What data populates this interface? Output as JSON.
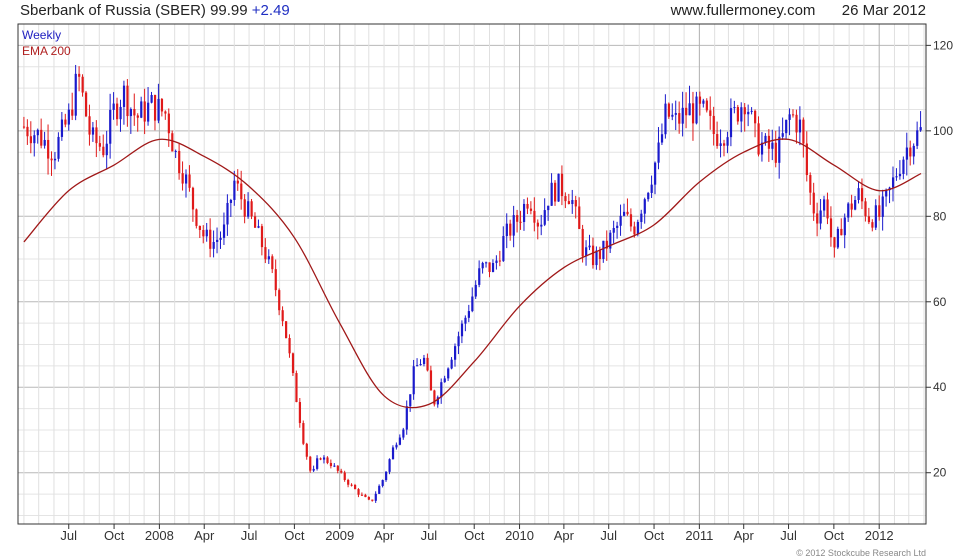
{
  "header": {
    "title": "Sberbank of Russia (SBER) 99.99",
    "change": "+2.49",
    "site": "www.fullermoney.com",
    "date": "26 Mar 2012"
  },
  "legend": {
    "weekly": "Weekly",
    "ema": "EMA 200"
  },
  "footer": {
    "copyright": "© 2012 Stockcube Research Ltd"
  },
  "colors": {
    "up": "#1a1acc",
    "down": "#e01a1a",
    "ema": "#a01818",
    "grid": "#c8c8c8",
    "axis": "#333333"
  },
  "chart_data": {
    "type": "line",
    "ylim": [
      8,
      125
    ],
    "yticks": [
      20,
      40,
      60,
      80,
      100,
      120
    ],
    "grid": true,
    "legend_position": "top-left",
    "xticks": [
      {
        "label": "Jul",
        "date": "2007-07-01"
      },
      {
        "label": "Oct",
        "date": "2007-10-01"
      },
      {
        "label": "2008",
        "date": "2008-01-01"
      },
      {
        "label": "Apr",
        "date": "2008-04-01"
      },
      {
        "label": "Jul",
        "date": "2008-07-01"
      },
      {
        "label": "Oct",
        "date": "2008-10-01"
      },
      {
        "label": "2009",
        "date": "2009-01-01"
      },
      {
        "label": "Apr",
        "date": "2009-04-01"
      },
      {
        "label": "Jul",
        "date": "2009-07-01"
      },
      {
        "label": "Oct",
        "date": "2009-10-01"
      },
      {
        "label": "2010",
        "date": "2010-01-01"
      },
      {
        "label": "Apr",
        "date": "2010-04-01"
      },
      {
        "label": "Jul",
        "date": "2010-07-01"
      },
      {
        "label": "Oct",
        "date": "2010-10-01"
      },
      {
        "label": "2011",
        "date": "2011-01-01"
      },
      {
        "label": "Apr",
        "date": "2011-04-01"
      },
      {
        "label": "Jul",
        "date": "2011-07-01"
      },
      {
        "label": "Oct",
        "date": "2011-10-01"
      },
      {
        "label": "2012",
        "date": "2012-01-01"
      }
    ],
    "series": [
      {
        "name": "Weekly",
        "points": [
          {
            "date": "2007-04-01",
            "close": 101
          },
          {
            "date": "2007-05-01",
            "close": 99
          },
          {
            "date": "2007-06-01",
            "close": 95
          },
          {
            "date": "2007-07-01",
            "close": 103
          },
          {
            "date": "2007-07-20",
            "close": 113
          },
          {
            "date": "2007-08-15",
            "close": 98
          },
          {
            "date": "2007-09-10",
            "close": 96
          },
          {
            "date": "2007-10-01",
            "close": 105
          },
          {
            "date": "2007-10-20",
            "close": 109
          },
          {
            "date": "2007-11-15",
            "close": 103
          },
          {
            "date": "2007-12-15",
            "close": 106
          },
          {
            "date": "2008-01-15",
            "close": 104
          },
          {
            "date": "2008-02-01",
            "close": 95
          },
          {
            "date": "2008-02-20",
            "close": 90
          },
          {
            "date": "2008-03-10",
            "close": 82
          },
          {
            "date": "2008-04-01",
            "close": 75
          },
          {
            "date": "2008-04-20",
            "close": 74
          },
          {
            "date": "2008-05-10",
            "close": 76
          },
          {
            "date": "2008-06-01",
            "close": 88
          },
          {
            "date": "2008-06-20",
            "close": 83
          },
          {
            "date": "2008-07-10",
            "close": 78
          },
          {
            "date": "2008-08-01",
            "close": 72
          },
          {
            "date": "2008-08-20",
            "close": 65
          },
          {
            "date": "2008-09-10",
            "close": 55
          },
          {
            "date": "2008-10-01",
            "close": 40
          },
          {
            "date": "2008-10-20",
            "close": 27
          },
          {
            "date": "2008-11-05",
            "close": 19
          },
          {
            "date": "2008-11-20",
            "close": 24
          },
          {
            "date": "2008-12-15",
            "close": 22
          },
          {
            "date": "2009-01-15",
            "close": 18
          },
          {
            "date": "2009-02-10",
            "close": 15
          },
          {
            "date": "2009-03-05",
            "close": 13
          },
          {
            "date": "2009-04-01",
            "close": 19
          },
          {
            "date": "2009-04-20",
            "close": 26
          },
          {
            "date": "2009-05-10",
            "close": 31
          },
          {
            "date": "2009-06-01",
            "close": 44
          },
          {
            "date": "2009-06-20",
            "close": 47
          },
          {
            "date": "2009-07-10",
            "close": 36
          },
          {
            "date": "2009-08-01",
            "close": 43
          },
          {
            "date": "2009-08-20",
            "close": 49
          },
          {
            "date": "2009-09-15",
            "close": 57
          },
          {
            "date": "2009-10-15",
            "close": 68
          },
          {
            "date": "2009-11-10",
            "close": 68
          },
          {
            "date": "2009-12-01",
            "close": 75
          },
          {
            "date": "2010-01-01",
            "close": 80
          },
          {
            "date": "2010-01-20",
            "close": 85
          },
          {
            "date": "2010-02-10",
            "close": 78
          },
          {
            "date": "2010-03-01",
            "close": 85
          },
          {
            "date": "2010-03-20",
            "close": 87
          },
          {
            "date": "2010-04-15",
            "close": 85
          },
          {
            "date": "2010-05-10",
            "close": 72
          },
          {
            "date": "2010-06-01",
            "close": 70
          },
          {
            "date": "2010-06-20",
            "close": 72
          },
          {
            "date": "2010-07-10",
            "close": 76
          },
          {
            "date": "2010-08-01",
            "close": 80
          },
          {
            "date": "2010-08-20",
            "close": 77
          },
          {
            "date": "2010-09-15",
            "close": 86
          },
          {
            "date": "2010-10-10",
            "close": 95
          },
          {
            "date": "2010-10-25",
            "close": 104
          },
          {
            "date": "2010-11-15",
            "close": 102
          },
          {
            "date": "2010-12-10",
            "close": 105
          },
          {
            "date": "2011-01-10",
            "close": 104
          },
          {
            "date": "2011-02-01",
            "close": 99
          },
          {
            "date": "2011-02-20",
            "close": 100
          },
          {
            "date": "2011-03-15",
            "close": 104
          },
          {
            "date": "2011-04-05",
            "close": 108
          },
          {
            "date": "2011-04-25",
            "close": 98
          },
          {
            "date": "2011-05-15",
            "close": 96
          },
          {
            "date": "2011-06-10",
            "close": 95
          },
          {
            "date": "2011-07-05",
            "close": 104
          },
          {
            "date": "2011-07-25",
            "close": 101
          },
          {
            "date": "2011-08-10",
            "close": 87
          },
          {
            "date": "2011-08-25",
            "close": 80
          },
          {
            "date": "2011-09-15",
            "close": 84
          },
          {
            "date": "2011-10-01",
            "close": 70
          },
          {
            "date": "2011-10-15",
            "close": 78
          },
          {
            "date": "2011-11-01",
            "close": 82
          },
          {
            "date": "2011-11-20",
            "close": 85
          },
          {
            "date": "2011-12-10",
            "close": 80
          },
          {
            "date": "2012-01-01",
            "close": 80
          },
          {
            "date": "2012-01-20",
            "close": 85
          },
          {
            "date": "2012-02-10",
            "close": 92
          },
          {
            "date": "2012-03-01",
            "close": 97
          },
          {
            "date": "2012-03-26",
            "close": 99.99
          }
        ]
      },
      {
        "name": "EMA 200",
        "points": [
          {
            "date": "2007-04-01",
            "close": 74
          },
          {
            "date": "2007-07-01",
            "close": 86
          },
          {
            "date": "2007-10-01",
            "close": 92
          },
          {
            "date": "2008-01-01",
            "close": 98
          },
          {
            "date": "2008-04-01",
            "close": 94
          },
          {
            "date": "2008-07-01",
            "close": 87
          },
          {
            "date": "2008-10-01",
            "close": 75
          },
          {
            "date": "2009-01-01",
            "close": 55
          },
          {
            "date": "2009-04-01",
            "close": 38
          },
          {
            "date": "2009-07-01",
            "close": 36
          },
          {
            "date": "2009-10-01",
            "close": 46
          },
          {
            "date": "2010-01-01",
            "close": 59
          },
          {
            "date": "2010-04-01",
            "close": 68
          },
          {
            "date": "2010-07-01",
            "close": 73
          },
          {
            "date": "2010-10-01",
            "close": 78
          },
          {
            "date": "2011-01-01",
            "close": 88
          },
          {
            "date": "2011-04-01",
            "close": 95
          },
          {
            "date": "2011-07-01",
            "close": 98
          },
          {
            "date": "2011-10-01",
            "close": 92
          },
          {
            "date": "2012-01-01",
            "close": 86
          },
          {
            "date": "2012-03-26",
            "close": 90
          }
        ]
      }
    ]
  }
}
